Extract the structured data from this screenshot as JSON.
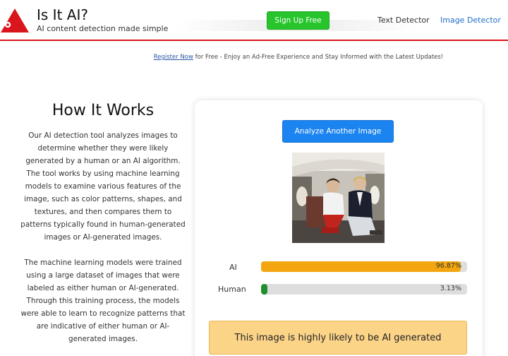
{
  "header": {
    "title": "Is It AI?",
    "tagline": "AI content detection made simple",
    "signup_label": "Sign Up Free",
    "nav": {
      "text_detector": "Text Detector",
      "image_detector": "Image Detector"
    },
    "logo_icon": "red-triangle-logo-icon"
  },
  "banner": {
    "link_text": "Register Now",
    "text": " for Free - Enjoy an Ad-Free Experience and Stay Informed with the Latest Updates!"
  },
  "how_it_works": {
    "title": "How It Works",
    "paragraph1": "Our AI detection tool analyzes images to determine whether they were likely generated by a human or an AI algorithm. The tool works by using machine learning models to examine various features of the image, such as color patterns, shapes, and textures, and then compares them to patterns typically found in human-generated images or AI-generated images.",
    "paragraph2": "The machine learning models were trained using a large dataset of images that were labeled as either human or AI-generated. Through this training process, the models were able to learn to recognize patterns that are indicative of either human or AI-generated images."
  },
  "result": {
    "analyze_button": "Analyze Another Image",
    "ai_label": "AI",
    "ai_percent_text": "96.87%",
    "ai_fraction": 0.9687,
    "human_label": "Human",
    "human_percent_text": "3.13%",
    "human_fraction": 0.0313,
    "verdict": "This image is highly likely to be AI generated"
  },
  "colors": {
    "accent_red": "#d9161c",
    "signup_green": "#27c42b",
    "analyze_blue": "#1b84f0",
    "ai_bar": "#f3a60f",
    "human_bar": "#1e8f2c",
    "verdict_bg": "#fcd488"
  }
}
